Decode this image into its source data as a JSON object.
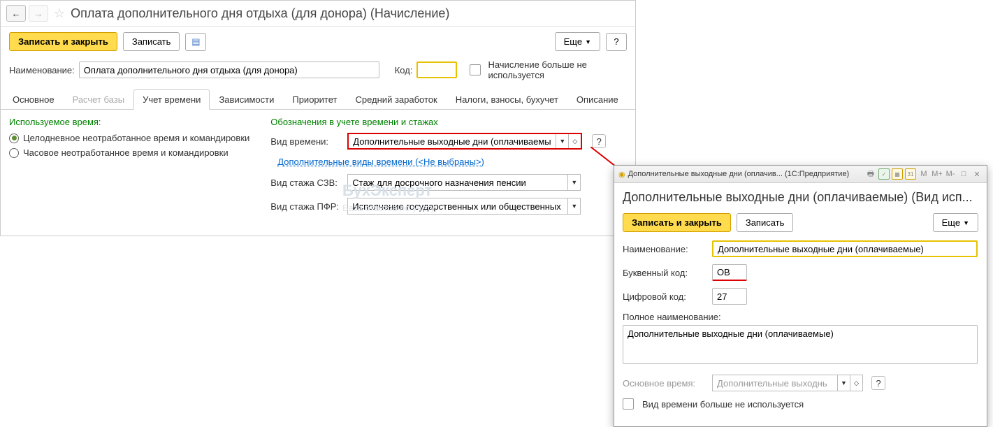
{
  "main": {
    "title": "Оплата дополнительного дня отдыха (для донора) (Начисление)",
    "toolbar": {
      "save_close": "Записать и закрыть",
      "save": "Записать",
      "more": "Еще",
      "help": "?"
    },
    "form": {
      "name_label": "Наименование:",
      "name_value": "Оплата дополнительного дня отдыха (для донора)",
      "code_label": "Код:",
      "code_value": "",
      "not_used_label": "Начисление больше не используется"
    },
    "tabs": [
      "Основное",
      "Расчет базы",
      "Учет времени",
      "Зависимости",
      "Приоритет",
      "Средний заработок",
      "Налоги, взносы, бухучет",
      "Описание"
    ],
    "time_tab": {
      "used_time_title": "Используемое время:",
      "radio1": "Целодневное неотработанное время и командировки",
      "radio2": "Часовое неотработанное время и командировки",
      "designations_title": "Обозначения в учете времени и стажах",
      "time_type_label": "Вид времени:",
      "time_type_value": "Дополнительные выходные дни (оплачиваемые)",
      "additional_link": "Дополнительные виды времени (<Не выбраны>)",
      "szv_label": "Вид стажа СЗВ:",
      "szv_value": "Стаж для досрочного назначения пенсии",
      "pfr_label": "Вид стажа ПФР:",
      "pfr_value": "Исполнение государственных или общественных обяза"
    }
  },
  "popup": {
    "titlebar": "Дополнительные выходные дни (оплачив...   (1С:Предприятие)",
    "heading": "Дополнительные выходные дни (оплачиваемые) (Вид исп...",
    "toolbar": {
      "save_close": "Записать и закрыть",
      "save": "Записать",
      "more": "Еще"
    },
    "name_label": "Наименование:",
    "name_value": "Дополнительные выходные дни (оплачиваемые)",
    "letter_label": "Буквенный код:",
    "letter_value": "ОВ",
    "numeric_label": "Цифровой код:",
    "numeric_value": "27",
    "full_name_label": "Полное наименование:",
    "full_name_value": "Дополнительные выходные дни (оплачиваемые)",
    "base_time_label": "Основное время:",
    "base_time_value": "Дополнительные выходнь",
    "not_used_label": "Вид времени больше не используется"
  }
}
